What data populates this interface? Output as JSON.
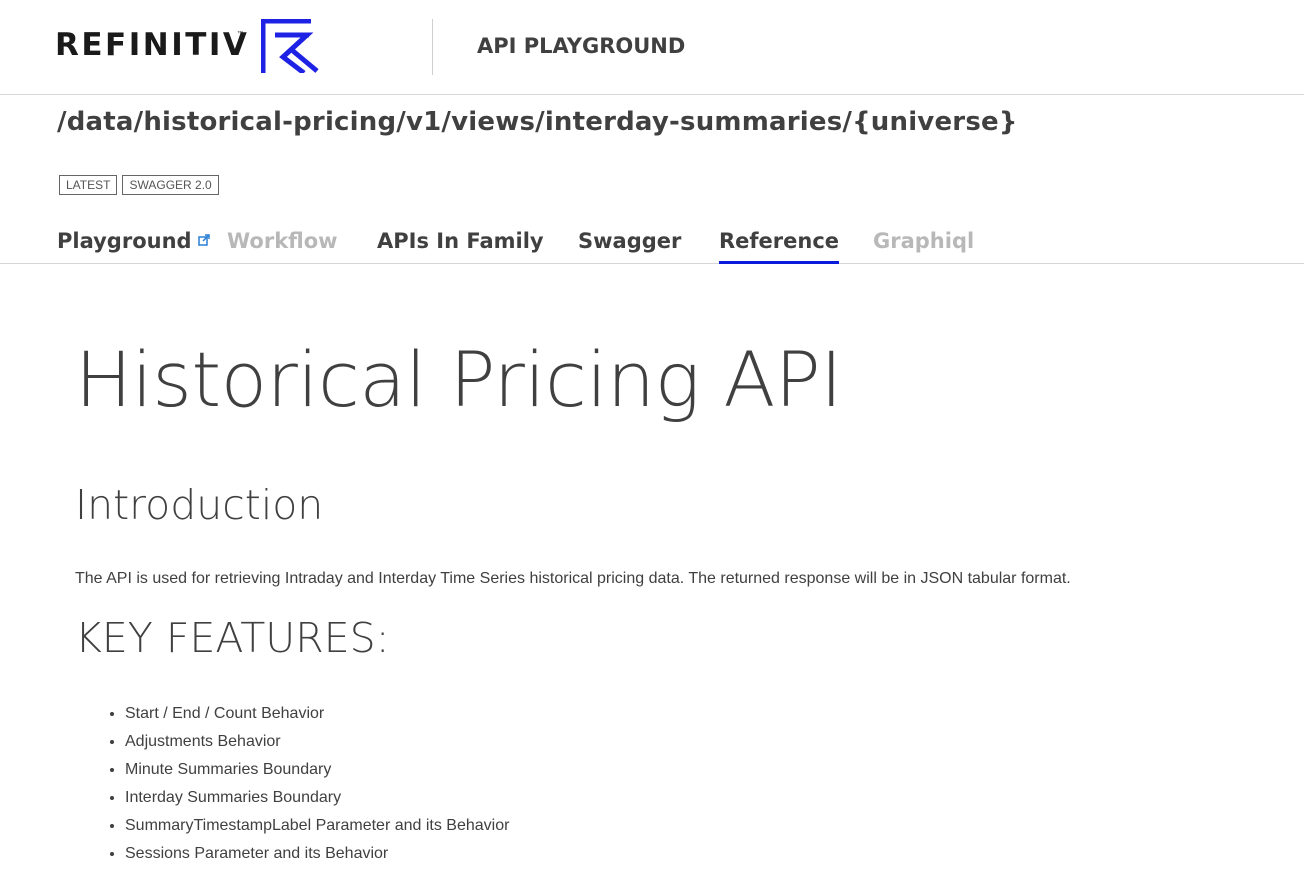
{
  "header": {
    "logo_text": "REFINITIV",
    "logo_tm": "™",
    "title": "API PLAYGROUND"
  },
  "endpoint": "/data/historical-pricing/v1/views/interday-summaries/{universe}",
  "badges": [
    "LATEST",
    "SWAGGER 2.0"
  ],
  "tabs": [
    {
      "label": "Playground",
      "state": "normal",
      "external": true
    },
    {
      "label": "Workflow",
      "state": "disabled"
    },
    {
      "label": "APIs In Family",
      "state": "normal"
    },
    {
      "label": "Swagger",
      "state": "normal"
    },
    {
      "label": "Reference",
      "state": "active"
    },
    {
      "label": "Graphiql",
      "state": "disabled"
    }
  ],
  "content": {
    "title": "Historical Pricing API",
    "introduction_heading": "Introduction",
    "introduction_text": "The API is used for retrieving Intraday and Interday Time Series historical pricing data. The returned response will be in JSON tabular format.",
    "key_features_heading": "KEY FEATURES:",
    "key_features": [
      "Start / End / Count Behavior",
      "Adjustments Behavior",
      "Minute Summaries Boundary",
      "Interday Summaries Boundary",
      "SummaryTimestampLabel Parameter and its Behavior",
      "Sessions Parameter and its Behavior"
    ]
  },
  "colors": {
    "accent": "#0b1bdb",
    "logo_mark": "#1e22e5",
    "external_icon": "#2a7fd4",
    "disabled_tab": "#b8b8b8",
    "text": "#404040"
  }
}
